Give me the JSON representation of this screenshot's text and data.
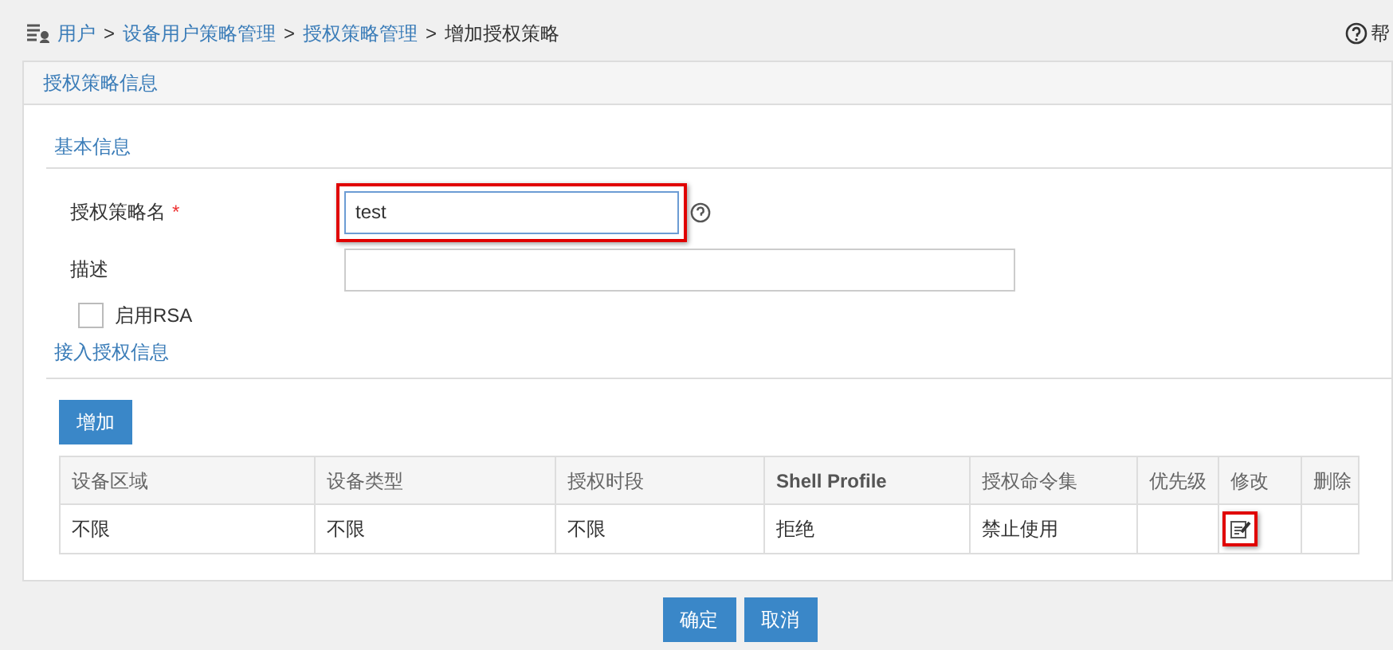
{
  "breadcrumb": {
    "links": [
      "用户",
      "设备用户策略管理",
      "授权策略管理"
    ],
    "separator": ">",
    "current": "增加授权策略"
  },
  "help": {
    "label": "帮"
  },
  "panel": {
    "title": "授权策略信息"
  },
  "basic": {
    "title": "基本信息",
    "fields": [
      {
        "label": "授权策略名",
        "required_mark": "*",
        "value": "test",
        "highlighted": true,
        "hint": true
      },
      {
        "label": "描述",
        "highlighted": false,
        "hint": false
      }
    ],
    "rsa": {
      "label": "启用RSA",
      "checked": false
    }
  },
  "access": {
    "title": "接入授权信息",
    "add_button": "增加",
    "table": {
      "columns": [
        "设备区域",
        "设备类型",
        "授权时段",
        "Shell Profile",
        "授权命令集",
        "优先级",
        "修改",
        "删除"
      ],
      "rows": [
        {
          "cells": [
            "不限",
            "不限",
            "不限",
            "拒绝",
            "禁止使用",
            ""
          ],
          "edit_highlighted": true
        }
      ]
    }
  },
  "buttons": [
    "确定",
    "取消"
  ]
}
